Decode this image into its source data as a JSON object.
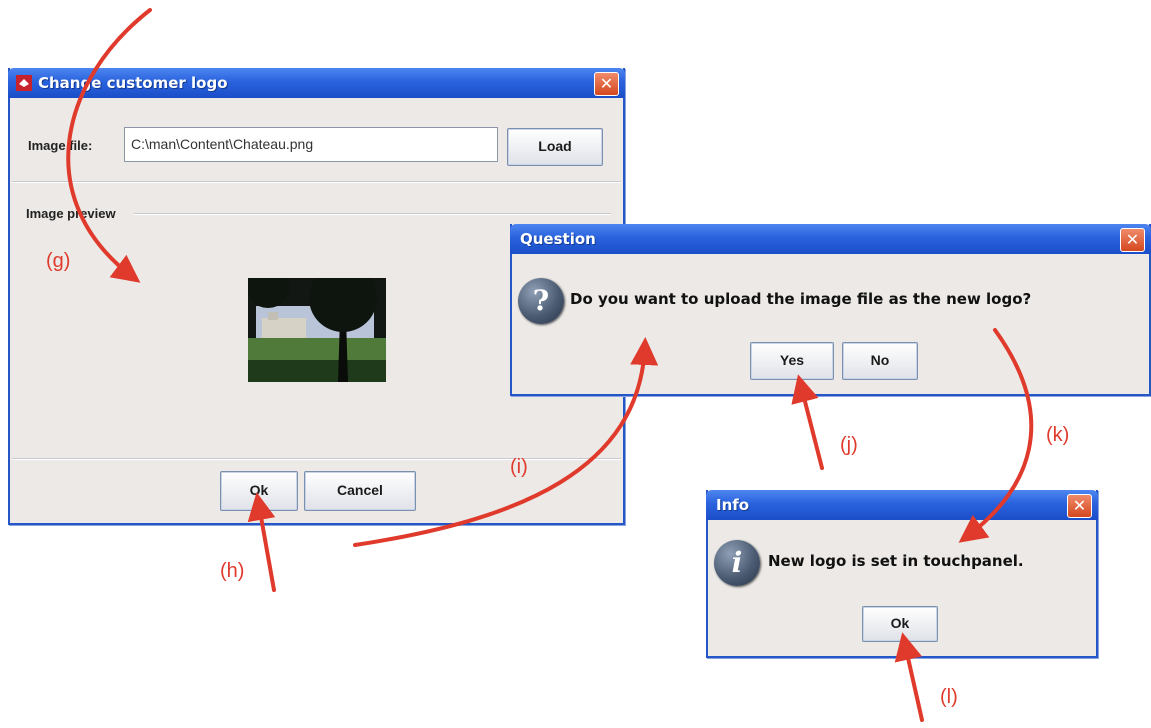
{
  "customer_logo_dialog": {
    "title": "Change customer logo",
    "image_file_label": "Image file:",
    "image_file_value": "C:\\man\\Content\\Chateau.png",
    "load_label": "Load",
    "preview_label": "Image preview",
    "ok_label": "Ok",
    "cancel_label": "Cancel",
    "close_glyph": "✕"
  },
  "question_dialog": {
    "title": "Question",
    "message": "Do you want to upload the image file as the new logo?",
    "icon": "question-icon",
    "icon_glyph": "?",
    "yes_label": "Yes",
    "no_label": "No",
    "close_glyph": "✕"
  },
  "info_dialog": {
    "title": "Info",
    "message": "New logo is set in touchpanel.",
    "icon": "info-icon",
    "icon_glyph": "i",
    "ok_label": "Ok",
    "close_glyph": "✕"
  },
  "annotations": {
    "g": "(g)",
    "h": "(h)",
    "i": "(i)",
    "j": "(j)",
    "k": "(k)",
    "l": "(l)"
  },
  "colors": {
    "annotation": "#e03a2c",
    "titlebar": "#2a62dd",
    "close": "#d4481f"
  }
}
